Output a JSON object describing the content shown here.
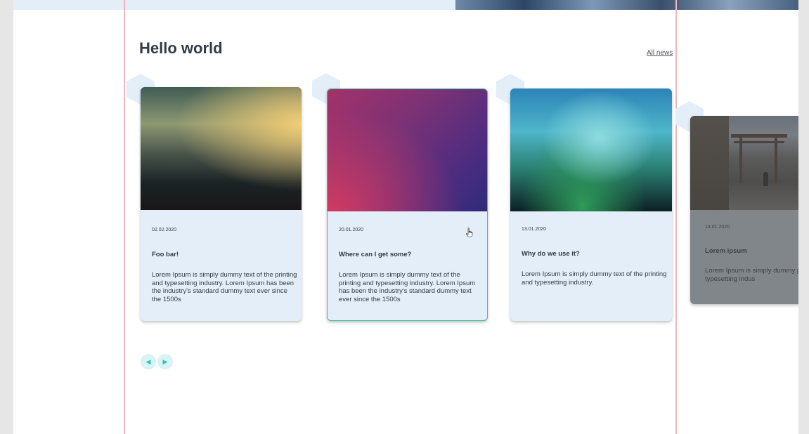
{
  "section": {
    "title": "Hello world",
    "all_news_label": "All news"
  },
  "cards": [
    {
      "date": "02.02.2020",
      "title": "Foo bar!",
      "text": "Lorem Ipsum is simply dummy text of the printing and typesetting industry. Lorem Ipsum has been the industry's standard dummy text ever since the 1500s"
    },
    {
      "date": "20.01.2020",
      "title": "Where can I get some?",
      "text": "Lorem Ipsum is simply dummy text of the printing and typesetting industry. Lorem Ipsum has been the industry's standard dummy text ever since the 1500s",
      "state": "hovered"
    },
    {
      "date": "13.01.2020",
      "title": "Why do we use it?",
      "text": "Lorem Ipsum is simply dummy text of the printing and typesetting industry."
    },
    {
      "date": "13.01.2020",
      "title": "Lorem ipsum",
      "text": "Lorem Ipsum is simply dummy printing and typesetting indus"
    }
  ],
  "pager": {
    "prev_icon": "◀",
    "next_icon": "▶"
  },
  "colors": {
    "card_bg": "#e3eef9",
    "accent_border": "#3fbf9e",
    "pager_bg": "#d8f3f5",
    "pager_icon": "#2cc3b5",
    "guide_line": "#f2b6bd"
  }
}
